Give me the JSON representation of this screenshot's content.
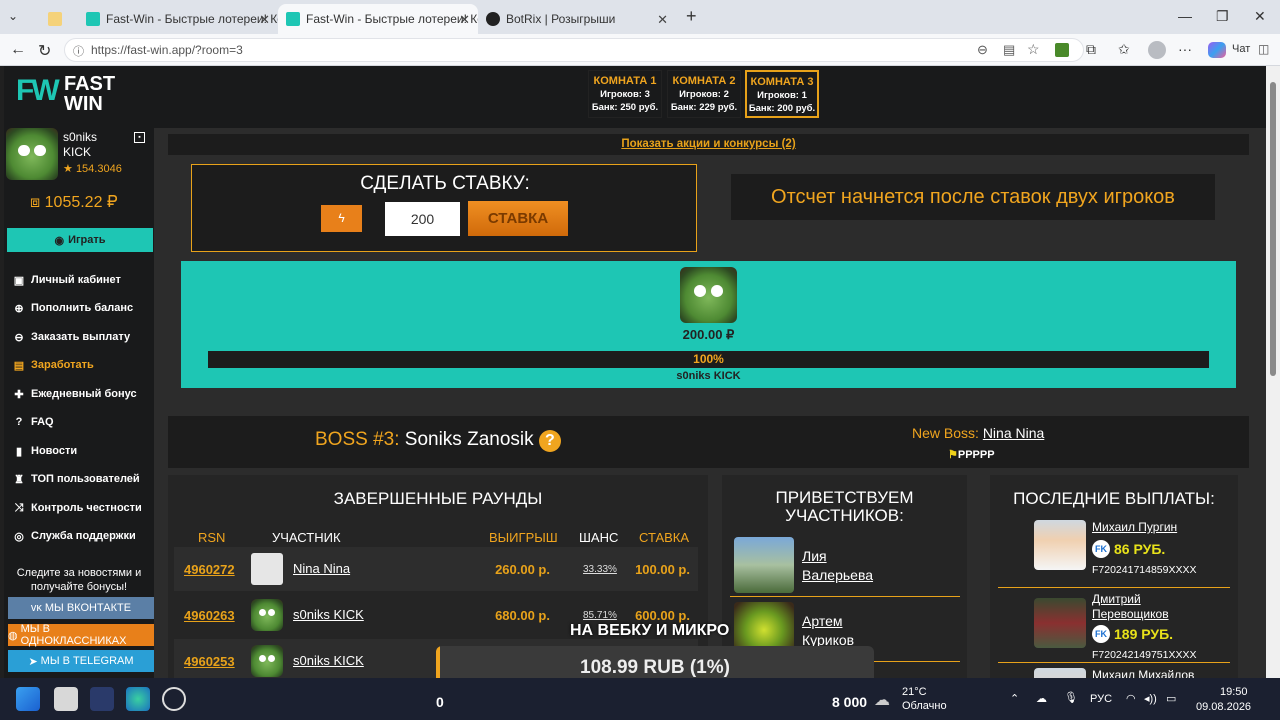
{
  "browser": {
    "tabs": [
      {
        "title": "Fast-Win - Быстрые лотереи! Ком",
        "active": false
      },
      {
        "title": "Fast-Win - Быстрые лотереи! Ком",
        "active": true
      },
      {
        "title": "BotRix | Розыгрыши",
        "active": false
      }
    ],
    "url": "https://fast-win.app/?room=3",
    "chat_label": "Чат"
  },
  "header": {
    "logo_line1": "FAST",
    "logo_line2": "WIN",
    "logo_mark": "FW",
    "rooms": [
      {
        "title": "КОМНАТА 1",
        "players": "Игроков: 3",
        "bank": "Банк: 250 руб.",
        "active": false
      },
      {
        "title": "КОМНАТА 2",
        "players": "Игроков: 2",
        "bank": "Банк: 229 руб.",
        "active": false
      },
      {
        "title": "КОМНАТА 3",
        "players": "Игроков: 1",
        "bank": "Банк: 200 руб.",
        "active": true
      }
    ]
  },
  "user": {
    "name_line1": "s0niks",
    "name_line2": "KICK",
    "rating": "154.3046",
    "balance": "1055.22 ₽",
    "play_label": "Играть"
  },
  "sidebar": {
    "items": [
      {
        "label": "Личный кабинет",
        "icon": "wallet-icon"
      },
      {
        "label": "Пополнить баланс",
        "icon": "plus-circle-icon"
      },
      {
        "label": "Заказать выплату",
        "icon": "arrow-down-circle-icon"
      },
      {
        "label": "Заработать",
        "icon": "cash-icon"
      },
      {
        "label": "Ежедневный бонус",
        "icon": "gift-icon"
      },
      {
        "label": "FAQ",
        "icon": "question-icon"
      },
      {
        "label": "Новости",
        "icon": "bookmark-icon"
      },
      {
        "label": "ТОП пользователей",
        "icon": "trophy-icon"
      },
      {
        "label": "Контроль честности",
        "icon": "shuffle-icon"
      },
      {
        "label": "Служба поддержки",
        "icon": "support-icon"
      }
    ],
    "news_text_line1": "Следите за новостями и",
    "news_text_line2": "получайте бонусы!",
    "social": [
      {
        "label": "МЫ ВКОНТАКТЕ",
        "color": "#5b7fa6"
      },
      {
        "label": "МЫ В ОДНОКЛАССНИКАХ",
        "color": "#e8801a"
      },
      {
        "label": "МЫ В TELEGRAM",
        "color": "#2a9fd6"
      }
    ]
  },
  "promo_link": "Показать акции и конкурсы (2)",
  "bet": {
    "title": "СДЕЛАТЬ СТАВКУ:",
    "amount": "200",
    "button_label": "СТАВКА",
    "countdown_text": "Отсчет начнется после ставок двух игроков"
  },
  "round": {
    "amount": "200.00 ₽",
    "percent": "100%",
    "percent_value": 100,
    "player": "s0niks KICK"
  },
  "boss": {
    "label": "BOSS #3:",
    "name": "Soniks Zanosik",
    "help": "?",
    "new_boss_label": "New Boss:",
    "new_boss_name": "Nina Nina",
    "flag_text": "PPPPP"
  },
  "rounds": {
    "title": "ЗАВЕРШЕННЫЕ РАУНДЫ",
    "columns": [
      "RSN",
      "УЧАСТНИК",
      "ВЫИГРЫШ",
      "ШАНС",
      "СТАВКА"
    ],
    "rows": [
      {
        "rsn": "4960272",
        "player": "Nina Nina",
        "win": "260.00 р.",
        "chance": "33.33%",
        "bet": "100.00 р.",
        "avatar": "default"
      },
      {
        "rsn": "4960263",
        "player": "s0niks KICK",
        "win": "680.00 р.",
        "chance": "85.71%",
        "bet": "600.00 р.",
        "avatar": "pig"
      },
      {
        "rsn": "4960253",
        "player": "s0niks KICK",
        "win": "",
        "chance": "",
        "bet": "",
        "avatar": "pig"
      }
    ]
  },
  "welcome": {
    "title_line1": "ПРИВЕТСТВУЕМ",
    "title_line2": "УЧАСТНИКОВ:",
    "users": [
      {
        "name_line1": "Лия",
        "name_line2": "Валерьева"
      },
      {
        "name_line1": "Артем",
        "name_line2": "Куриков"
      }
    ]
  },
  "payouts": {
    "title": "ПОСЛЕДНИЕ ВЫПЛАТЫ:",
    "items": [
      {
        "name_line1": "Михаил Пургин",
        "name_line2": "",
        "amount": "86 РУБ.",
        "code": "F720241714859XXXX"
      },
      {
        "name_line1": "Дмитрий",
        "name_line2": "Перевощиков",
        "amount": "189 РУБ.",
        "code": "F720242149751XXXX"
      },
      {
        "name_line1": "Михаил Михайлов",
        "name_line2": "",
        "amount": "",
        "code": ""
      }
    ]
  },
  "overlay": {
    "caption": "НА ВЕБКУ И МИКРО",
    "goal": "108.99 RUB (1%)",
    "counter_left": "0",
    "counter_right": "8 000"
  },
  "taskbar": {
    "temp": "21°C",
    "weather": "Облачно",
    "lang": "РУС",
    "time": "19:50",
    "date": "09.08.2026"
  }
}
